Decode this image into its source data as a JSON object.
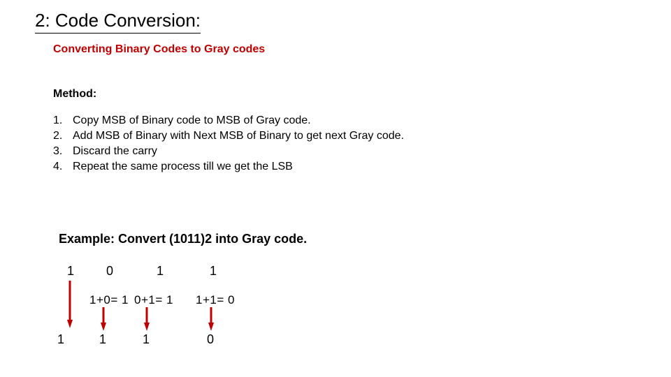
{
  "title": "2: Code Conversion:",
  "subtitle": "Converting Binary Codes to Gray codes",
  "method_label": "Method:",
  "steps": [
    {
      "n": "1.",
      "t": "Copy MSB of Binary code to MSB of Gray code."
    },
    {
      "n": "2.",
      "t": "Add MSB of Binary with Next MSB of Binary to get next Gray code."
    },
    {
      "n": "3.",
      "t": "Discard the carry"
    },
    {
      "n": "4.",
      "t": "Repeat the same process till we get the LSB"
    }
  ],
  "example_label": "Example: Convert (1011)2 into Gray code.",
  "binary": {
    "b0": "1",
    "b1": "0",
    "b2": "1",
    "b3": "1"
  },
  "calc": {
    "c1": "1+0= 1",
    "c2": "0+1= 1",
    "c3": "1+1=  0"
  },
  "gray": {
    "g0": "1",
    "g1": "1",
    "g2": "1",
    "g3": "0"
  }
}
